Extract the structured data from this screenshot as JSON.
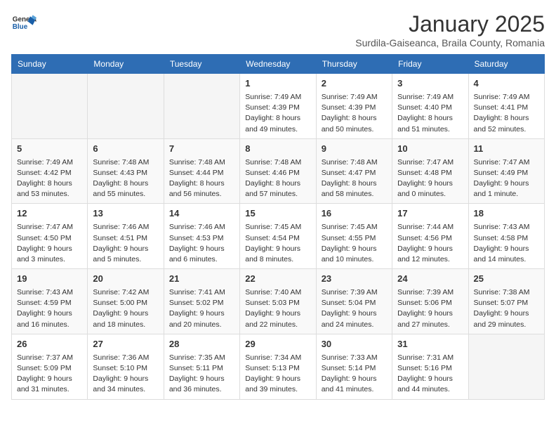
{
  "header": {
    "logo_general": "General",
    "logo_blue": "Blue",
    "month_year": "January 2025",
    "location": "Surdila-Gaiseanca, Braila County, Romania"
  },
  "weekdays": [
    "Sunday",
    "Monday",
    "Tuesday",
    "Wednesday",
    "Thursday",
    "Friday",
    "Saturday"
  ],
  "weeks": [
    [
      {
        "day": "",
        "info": ""
      },
      {
        "day": "",
        "info": ""
      },
      {
        "day": "",
        "info": ""
      },
      {
        "day": "1",
        "info": "Sunrise: 7:49 AM\nSunset: 4:39 PM\nDaylight: 8 hours and 49 minutes."
      },
      {
        "day": "2",
        "info": "Sunrise: 7:49 AM\nSunset: 4:39 PM\nDaylight: 8 hours and 50 minutes."
      },
      {
        "day": "3",
        "info": "Sunrise: 7:49 AM\nSunset: 4:40 PM\nDaylight: 8 hours and 51 minutes."
      },
      {
        "day": "4",
        "info": "Sunrise: 7:49 AM\nSunset: 4:41 PM\nDaylight: 8 hours and 52 minutes."
      }
    ],
    [
      {
        "day": "5",
        "info": "Sunrise: 7:49 AM\nSunset: 4:42 PM\nDaylight: 8 hours and 53 minutes."
      },
      {
        "day": "6",
        "info": "Sunrise: 7:48 AM\nSunset: 4:43 PM\nDaylight: 8 hours and 55 minutes."
      },
      {
        "day": "7",
        "info": "Sunrise: 7:48 AM\nSunset: 4:44 PM\nDaylight: 8 hours and 56 minutes."
      },
      {
        "day": "8",
        "info": "Sunrise: 7:48 AM\nSunset: 4:46 PM\nDaylight: 8 hours and 57 minutes."
      },
      {
        "day": "9",
        "info": "Sunrise: 7:48 AM\nSunset: 4:47 PM\nDaylight: 8 hours and 58 minutes."
      },
      {
        "day": "10",
        "info": "Sunrise: 7:47 AM\nSunset: 4:48 PM\nDaylight: 9 hours and 0 minutes."
      },
      {
        "day": "11",
        "info": "Sunrise: 7:47 AM\nSunset: 4:49 PM\nDaylight: 9 hours and 1 minute."
      }
    ],
    [
      {
        "day": "12",
        "info": "Sunrise: 7:47 AM\nSunset: 4:50 PM\nDaylight: 9 hours and 3 minutes."
      },
      {
        "day": "13",
        "info": "Sunrise: 7:46 AM\nSunset: 4:51 PM\nDaylight: 9 hours and 5 minutes."
      },
      {
        "day": "14",
        "info": "Sunrise: 7:46 AM\nSunset: 4:53 PM\nDaylight: 9 hours and 6 minutes."
      },
      {
        "day": "15",
        "info": "Sunrise: 7:45 AM\nSunset: 4:54 PM\nDaylight: 9 hours and 8 minutes."
      },
      {
        "day": "16",
        "info": "Sunrise: 7:45 AM\nSunset: 4:55 PM\nDaylight: 9 hours and 10 minutes."
      },
      {
        "day": "17",
        "info": "Sunrise: 7:44 AM\nSunset: 4:56 PM\nDaylight: 9 hours and 12 minutes."
      },
      {
        "day": "18",
        "info": "Sunrise: 7:43 AM\nSunset: 4:58 PM\nDaylight: 9 hours and 14 minutes."
      }
    ],
    [
      {
        "day": "19",
        "info": "Sunrise: 7:43 AM\nSunset: 4:59 PM\nDaylight: 9 hours and 16 minutes."
      },
      {
        "day": "20",
        "info": "Sunrise: 7:42 AM\nSunset: 5:00 PM\nDaylight: 9 hours and 18 minutes."
      },
      {
        "day": "21",
        "info": "Sunrise: 7:41 AM\nSunset: 5:02 PM\nDaylight: 9 hours and 20 minutes."
      },
      {
        "day": "22",
        "info": "Sunrise: 7:40 AM\nSunset: 5:03 PM\nDaylight: 9 hours and 22 minutes."
      },
      {
        "day": "23",
        "info": "Sunrise: 7:39 AM\nSunset: 5:04 PM\nDaylight: 9 hours and 24 minutes."
      },
      {
        "day": "24",
        "info": "Sunrise: 7:39 AM\nSunset: 5:06 PM\nDaylight: 9 hours and 27 minutes."
      },
      {
        "day": "25",
        "info": "Sunrise: 7:38 AM\nSunset: 5:07 PM\nDaylight: 9 hours and 29 minutes."
      }
    ],
    [
      {
        "day": "26",
        "info": "Sunrise: 7:37 AM\nSunset: 5:09 PM\nDaylight: 9 hours and 31 minutes."
      },
      {
        "day": "27",
        "info": "Sunrise: 7:36 AM\nSunset: 5:10 PM\nDaylight: 9 hours and 34 minutes."
      },
      {
        "day": "28",
        "info": "Sunrise: 7:35 AM\nSunset: 5:11 PM\nDaylight: 9 hours and 36 minutes."
      },
      {
        "day": "29",
        "info": "Sunrise: 7:34 AM\nSunset: 5:13 PM\nDaylight: 9 hours and 39 minutes."
      },
      {
        "day": "30",
        "info": "Sunrise: 7:33 AM\nSunset: 5:14 PM\nDaylight: 9 hours and 41 minutes."
      },
      {
        "day": "31",
        "info": "Sunrise: 7:31 AM\nSunset: 5:16 PM\nDaylight: 9 hours and 44 minutes."
      },
      {
        "day": "",
        "info": ""
      }
    ]
  ]
}
